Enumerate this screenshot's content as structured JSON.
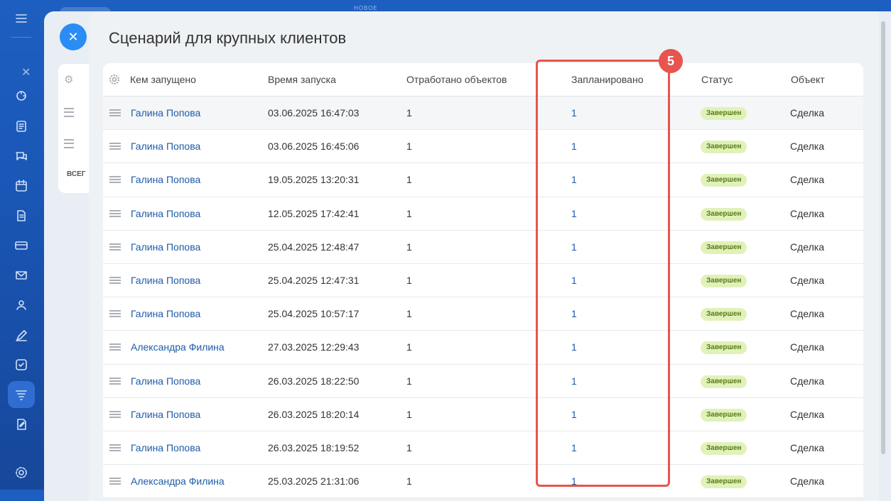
{
  "background": {
    "new_label": "НОВОЕ",
    "total_label": "ВСЕГ"
  },
  "slider": {
    "title": "Сценарий для крупных клиентов"
  },
  "table": {
    "headers": {
      "launched_by": "Кем запущено",
      "launch_time": "Время запуска",
      "processed": "Отработано объектов",
      "planned": "Запланировано",
      "status": "Статус",
      "object": "Объект"
    },
    "rows": [
      {
        "user": "Галина Попова",
        "time": "03.06.2025 16:47:03",
        "processed": "1",
        "planned": "1",
        "status": "Завершен",
        "object": "Сделка"
      },
      {
        "user": "Галина Попова",
        "time": "03.06.2025 16:45:06",
        "processed": "1",
        "planned": "1",
        "status": "Завершен",
        "object": "Сделка"
      },
      {
        "user": "Галина Попова",
        "time": "19.05.2025 13:20:31",
        "processed": "1",
        "planned": "1",
        "status": "Завершен",
        "object": "Сделка"
      },
      {
        "user": "Галина Попова",
        "time": "12.05.2025 17:42:41",
        "processed": "1",
        "planned": "1",
        "status": "Завершен",
        "object": "Сделка"
      },
      {
        "user": "Галина Попова",
        "time": "25.04.2025 12:48:47",
        "processed": "1",
        "planned": "1",
        "status": "Завершен",
        "object": "Сделка"
      },
      {
        "user": "Галина Попова",
        "time": "25.04.2025 12:47:31",
        "processed": "1",
        "planned": "1",
        "status": "Завершен",
        "object": "Сделка"
      },
      {
        "user": "Галина Попова",
        "time": "25.04.2025 10:57:17",
        "processed": "1",
        "planned": "1",
        "status": "Завершен",
        "object": "Сделка"
      },
      {
        "user": "Александра Филина",
        "time": "27.03.2025 12:29:43",
        "processed": "1",
        "planned": "1",
        "status": "Завершен",
        "object": "Сделка"
      },
      {
        "user": "Галина Попова",
        "time": "26.03.2025 18:22:50",
        "processed": "1",
        "planned": "1",
        "status": "Завершен",
        "object": "Сделка"
      },
      {
        "user": "Галина Попова",
        "time": "26.03.2025 18:20:14",
        "processed": "1",
        "planned": "1",
        "status": "Завершен",
        "object": "Сделка"
      },
      {
        "user": "Галина Попова",
        "time": "26.03.2025 18:19:52",
        "processed": "1",
        "planned": "1",
        "status": "Завершен",
        "object": "Сделка"
      },
      {
        "user": "Александра Филина",
        "time": "25.03.2025 21:31:06",
        "processed": "1",
        "planned": "1",
        "status": "Завершен",
        "object": "Сделка"
      }
    ]
  },
  "callout": {
    "number": "5"
  },
  "colors": {
    "accent": "#e8544f",
    "link": "#1e5ba8",
    "badge_bg": "#e0f2b9",
    "badge_text": "#5a7a16"
  }
}
